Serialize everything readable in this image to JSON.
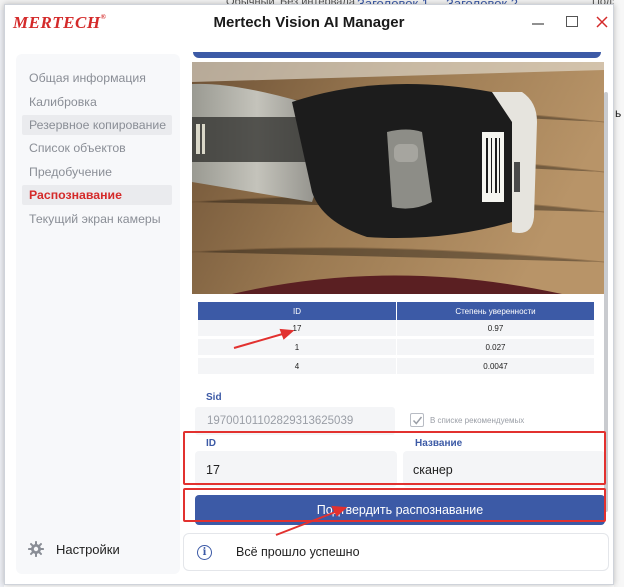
{
  "background": {
    "word_toolbar_items": [
      "Обычный",
      "Без интервала",
      "Заголовок 1",
      "Заголовок 2",
      "Подзаг"
    ],
    "right_edge_char": "ь"
  },
  "window": {
    "brand": "MERTECH",
    "title": "Mertech Vision AI Manager",
    "accent_color": "#d42a2a",
    "primary_color": "#3c5aa6"
  },
  "sidebar": {
    "items": [
      {
        "label": "Общая информация"
      },
      {
        "label": "Калибровка"
      },
      {
        "label": "Резервное копирование"
      },
      {
        "label": "Список объектов"
      },
      {
        "label": "Предобучение"
      },
      {
        "label": "Распознавание",
        "active": true
      },
      {
        "label": "Текущий экран камеры"
      }
    ],
    "settings_label": "Настройки",
    "settings_icon": "gear-icon"
  },
  "recognition": {
    "table": {
      "headers": [
        "ID",
        "Степень уверенности"
      ],
      "rows": [
        {
          "id": "17",
          "confidence": "0.97"
        },
        {
          "id": "1",
          "confidence": "0.027"
        },
        {
          "id": "4",
          "confidence": "0.0047"
        }
      ]
    },
    "sid_label": "Sid",
    "sid_value": "19700101102829313625039",
    "recommended_label": "В списке рекомендуемых",
    "recommended_checked": true,
    "id_label": "ID",
    "id_value": "17",
    "name_label": "Название",
    "name_value": "сканер",
    "confirm_button": "Подтвердить распознавание"
  },
  "status": {
    "icon": "info-icon",
    "message": "Всё прошло успешно"
  }
}
